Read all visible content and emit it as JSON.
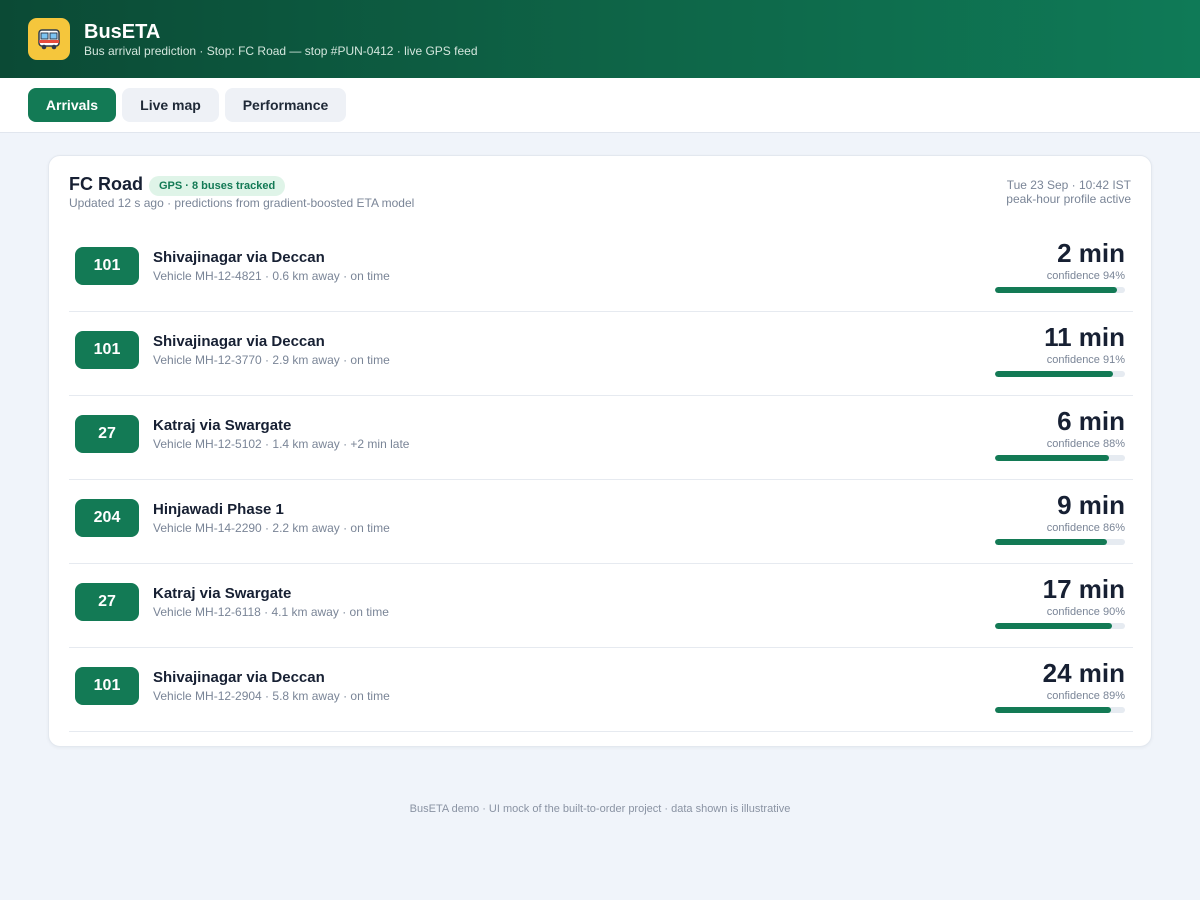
{
  "app": {
    "title": "BusETA",
    "subtitle": "Bus arrival prediction · Stop: FC Road — stop #PUN-0412 · live GPS feed",
    "logo_icon": "bus-icon"
  },
  "tabs": [
    {
      "label": "Arrivals",
      "active": true
    },
    {
      "label": "Live map",
      "active": false
    },
    {
      "label": "Performance",
      "active": false
    }
  ],
  "stop": {
    "name": "FC Road",
    "gps_badge": "GPS · 8 buses tracked",
    "updated": "Updated 12 s ago · predictions from gradient-boosted ETA model",
    "datetime": "Tue 23 Sep · 10:42 IST",
    "profile": "peak-hour profile active"
  },
  "arrivals": [
    {
      "route": "101",
      "destination": "Shivajinagar via Deccan",
      "vehicle": "Vehicle MH-12-4821 · 0.6 km away · on time",
      "eta": "2 min",
      "confidence_label": "confidence 94%",
      "confidence": 94
    },
    {
      "route": "101",
      "destination": "Shivajinagar via Deccan",
      "vehicle": "Vehicle MH-12-3770 · 2.9 km away · on time",
      "eta": "11 min",
      "confidence_label": "confidence 91%",
      "confidence": 91
    },
    {
      "route": "27",
      "destination": "Katraj via Swargate",
      "vehicle": "Vehicle MH-12-5102 · 1.4 km away · +2 min late",
      "eta": "6 min",
      "confidence_label": "confidence 88%",
      "confidence": 88
    },
    {
      "route": "204",
      "destination": "Hinjawadi Phase 1",
      "vehicle": "Vehicle MH-14-2290 · 2.2 km away · on time",
      "eta": "9 min",
      "confidence_label": "confidence 86%",
      "confidence": 86
    },
    {
      "route": "27",
      "destination": "Katraj via Swargate",
      "vehicle": "Vehicle MH-12-6118 · 4.1 km away · on time",
      "eta": "17 min",
      "confidence_label": "confidence 90%",
      "confidence": 90
    },
    {
      "route": "101",
      "destination": "Shivajinagar via Deccan",
      "vehicle": "Vehicle MH-12-2904 · 5.8 km away · on time",
      "eta": "24 min",
      "confidence_label": "confidence 89%",
      "confidence": 89
    }
  ],
  "footer": "BusETA demo · UI mock of the built-to-order project · data shown is illustrative",
  "colors": {
    "accent": "#137a55",
    "header_dark": "#0b4a35",
    "header_light": "#0f7a57",
    "logo_bg": "#f5c63c",
    "badge_bg": "#dff4e8",
    "page_bg": "#f0f4fa"
  }
}
